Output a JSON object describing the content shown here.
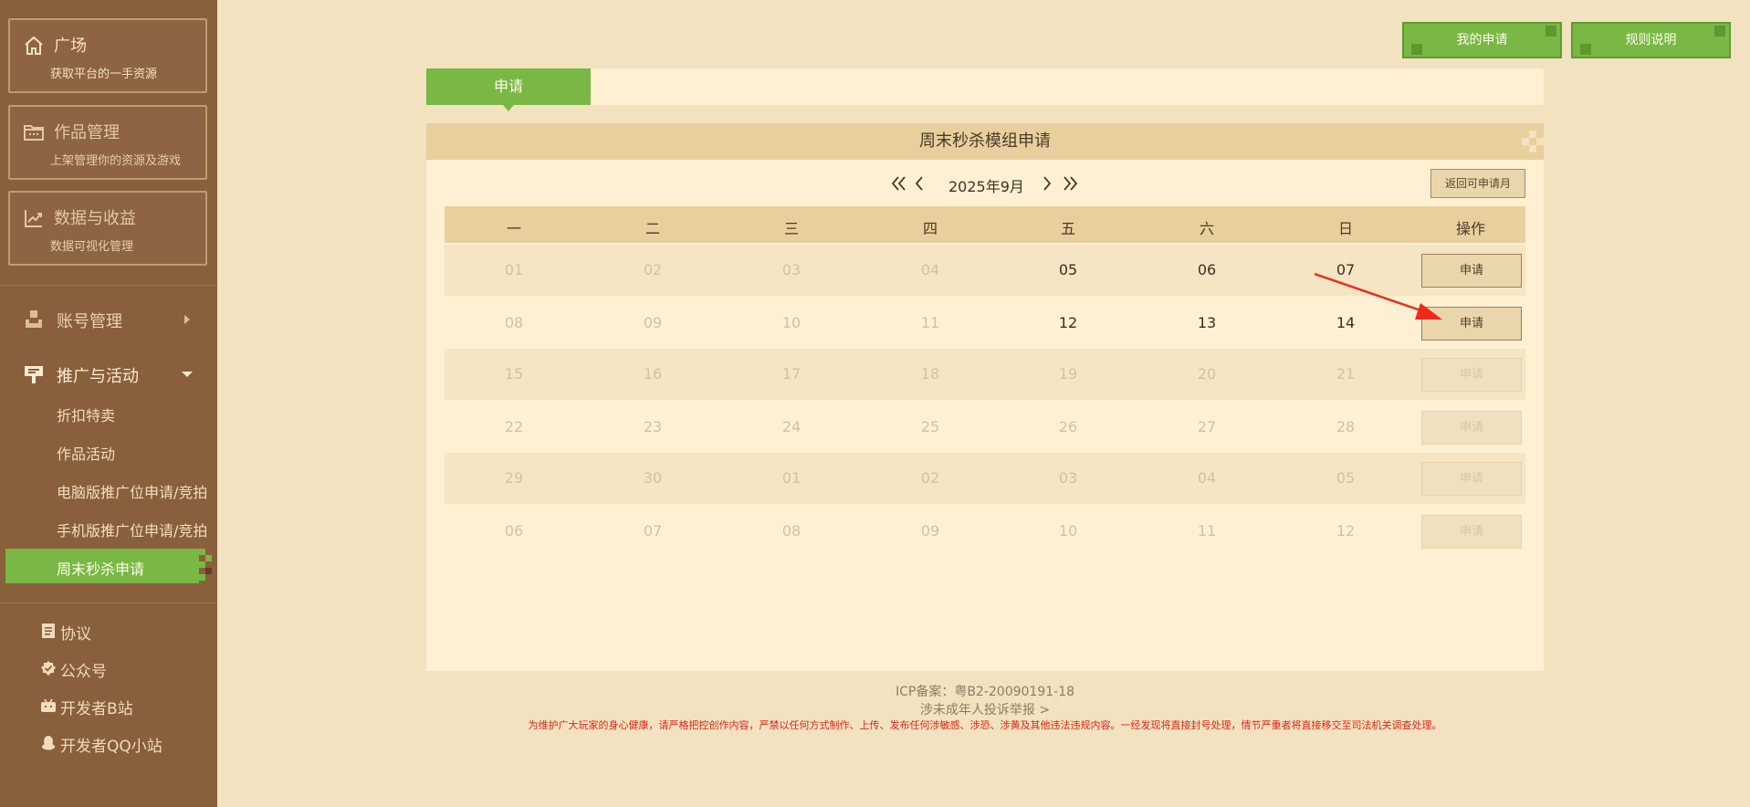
{
  "sidebar": {
    "cards": [
      {
        "title": "广场",
        "sub": "获取平台的一手资源",
        "icon": "home-icon"
      },
      {
        "title": "作品管理",
        "sub": "上架管理你的资源及游戏",
        "icon": "folder-icon"
      },
      {
        "title": "数据与收益",
        "sub": "数据可视化管理",
        "icon": "chart-icon"
      }
    ],
    "groups": {
      "account": {
        "label": "账号管理",
        "icon": "account-icon"
      },
      "promo": {
        "label": "推广与活动",
        "icon": "promo-icon"
      }
    },
    "promo_items": [
      "折扣特卖",
      "作品活动",
      "电脑版推广位申请/竞拍",
      "手机版推广位申请/竞拍",
      "周末秒杀申请"
    ],
    "links": [
      {
        "label": "协议",
        "icon": "document-icon"
      },
      {
        "label": "公众号",
        "icon": "verified-icon"
      },
      {
        "label": "开发者B站",
        "icon": "bilibili-icon"
      },
      {
        "label": "开发者QQ小站",
        "icon": "qq-icon"
      }
    ]
  },
  "top_buttons": {
    "my_apply": "我的申请",
    "rules": "规则说明"
  },
  "tab": {
    "label": "申请"
  },
  "panel": {
    "title": "周末秒杀模组申请",
    "month": "2025年9月",
    "return_label": "返回可申请月"
  },
  "calendar": {
    "headers": [
      "一",
      "二",
      "三",
      "四",
      "五",
      "六",
      "日",
      "操作"
    ],
    "apply_label": "申请",
    "rows": [
      {
        "days": [
          "01",
          "02",
          "03",
          "04",
          "05",
          "06",
          "07"
        ],
        "enabled": [
          false,
          false,
          false,
          false,
          true,
          true,
          true
        ],
        "can_apply": true
      },
      {
        "days": [
          "08",
          "09",
          "10",
          "11",
          "12",
          "13",
          "14"
        ],
        "enabled": [
          false,
          false,
          false,
          false,
          true,
          true,
          true
        ],
        "can_apply": true
      },
      {
        "days": [
          "15",
          "16",
          "17",
          "18",
          "19",
          "20",
          "21"
        ],
        "enabled": [
          false,
          false,
          false,
          false,
          false,
          false,
          false
        ],
        "can_apply": false
      },
      {
        "days": [
          "22",
          "23",
          "24",
          "25",
          "26",
          "27",
          "28"
        ],
        "enabled": [
          false,
          false,
          false,
          false,
          false,
          false,
          false
        ],
        "can_apply": false
      },
      {
        "days": [
          "29",
          "30",
          "01",
          "02",
          "03",
          "04",
          "05"
        ],
        "enabled": [
          false,
          false,
          false,
          false,
          false,
          false,
          false
        ],
        "can_apply": false
      },
      {
        "days": [
          "06",
          "07",
          "08",
          "09",
          "10",
          "11",
          "12"
        ],
        "enabled": [
          false,
          false,
          false,
          false,
          false,
          false,
          false
        ],
        "can_apply": false
      }
    ]
  },
  "footer": {
    "icp": "ICP备案：粤B2-20090191-18",
    "report": "涉未成年人投诉举报 >",
    "warning": "为维护广大玩家的身心健康，请严格把控创作内容，严禁以任何方式制作、上传、发布任何涉敏感、涉恐、涉黄及其他违法违规内容。一经发现将直接封号处理，情节严重者将直接移交至司法机关调查处理。"
  },
  "colors": {
    "accent_green": "#79b844",
    "sidebar_brown": "#8a5f3c",
    "annotation_red": "#ee2a1a",
    "warning_red": "#e0261a"
  }
}
